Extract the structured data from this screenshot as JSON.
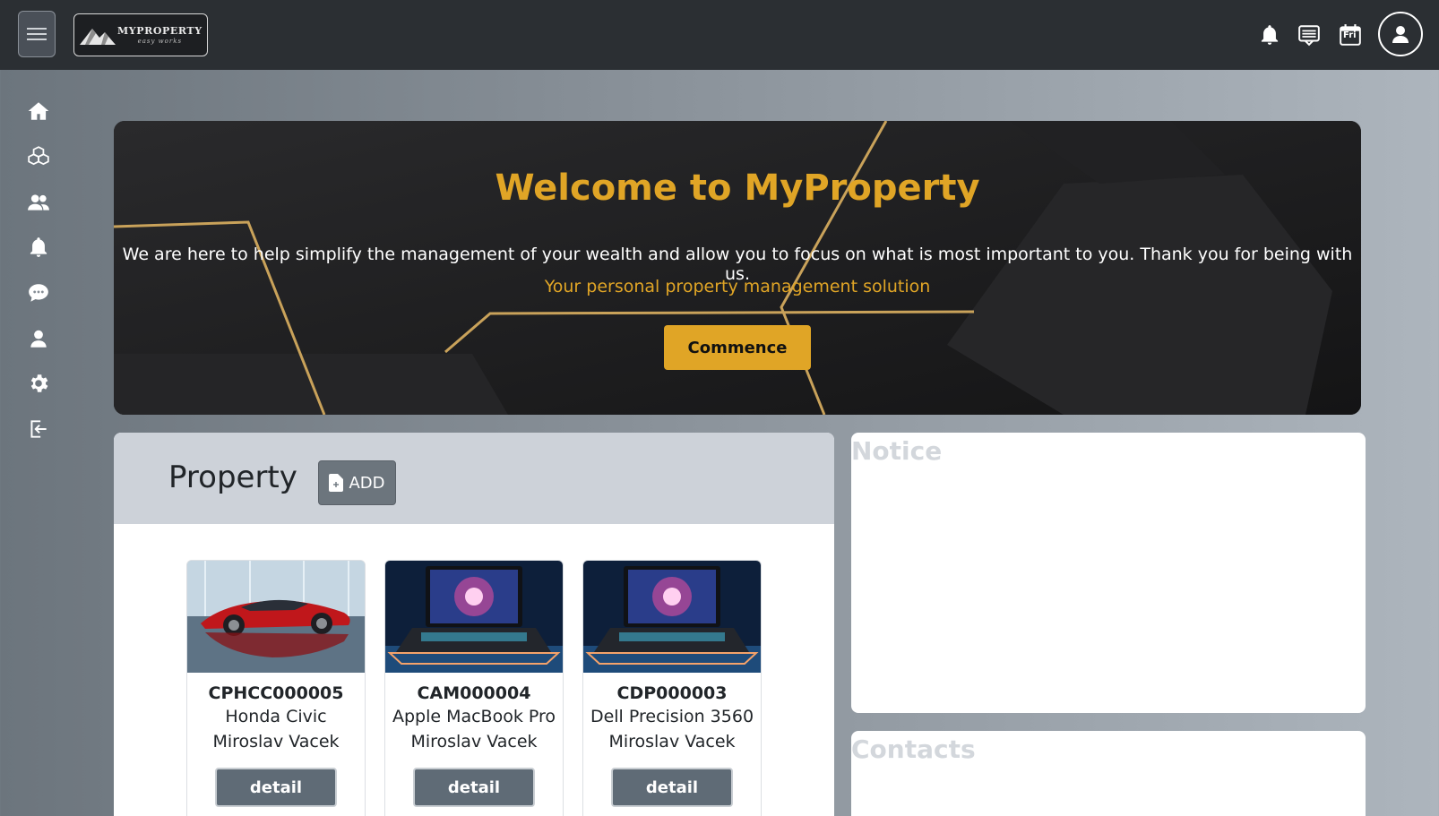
{
  "header": {
    "logo_main": "MYPROPERTY",
    "logo_sub": "easy works",
    "calendar_day": "Fri"
  },
  "hero": {
    "title": "Welcome to MyProperty",
    "text": "We are here to help simplify the management of your wealth and allow you to focus on what is most important to you. Thank you for being with us.",
    "subtitle": "Your personal property management solution",
    "button_label": "Commence"
  },
  "property": {
    "title": "Property",
    "add_label": "ADD",
    "cards": [
      {
        "code": "CPHCC000005",
        "name": "Honda Civic",
        "owner": "Miroslav Vacek",
        "button": "detail"
      },
      {
        "code": "CAM000004",
        "name": "Apple MacBook Pro",
        "owner": "Miroslav Vacek",
        "button": "detail"
      },
      {
        "code": "CDP000003",
        "name": "Dell Precision 3560",
        "owner": "Miroslav Vacek",
        "button": "detail"
      }
    ]
  },
  "notice": {
    "title": "Notice"
  },
  "contacts": {
    "title": "Contacts"
  },
  "colors": {
    "accent": "#e0a526",
    "topbar": "#2b2f33",
    "button_gray": "#6c757d"
  },
  "icons": {
    "sidebar": [
      "home-icon",
      "boxes-icon",
      "users-icon",
      "bell-icon",
      "chat-icon",
      "user-icon",
      "gear-icon",
      "logout-icon"
    ],
    "topbar": [
      "hamburger-icon",
      "bell-icon",
      "message-icon",
      "calendar-icon",
      "user-icon"
    ]
  }
}
